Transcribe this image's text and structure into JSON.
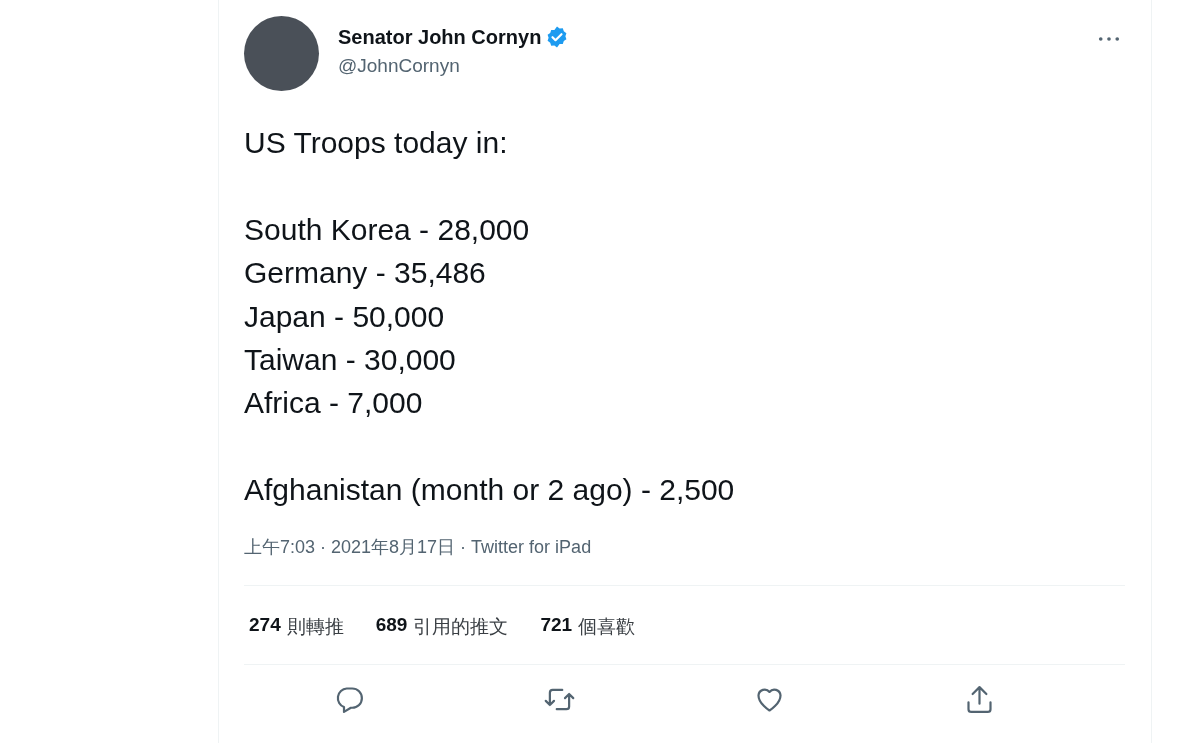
{
  "tweet": {
    "author": {
      "name": "Senator John Cornyn",
      "handle": "@JohnCornyn",
      "verified": true
    },
    "text": "US Troops today in:\n\nSouth Korea - 28,000\nGermany - 35,486\nJapan - 50,000\nTaiwan - 30,000\nAfrica - 7,000\n\nAfghanistan (month or 2 ago) - 2,500",
    "meta": "上午7:03 · 2021年8月17日 · Twitter for iPad",
    "stats": [
      {
        "count": "274",
        "label": "則轉推"
      },
      {
        "count": "689",
        "label": "引用的推文"
      },
      {
        "count": "721",
        "label": "個喜歡"
      }
    ],
    "actions": [
      {
        "kind": "reply"
      },
      {
        "kind": "retweet"
      },
      {
        "kind": "like"
      },
      {
        "kind": "share"
      }
    ]
  }
}
